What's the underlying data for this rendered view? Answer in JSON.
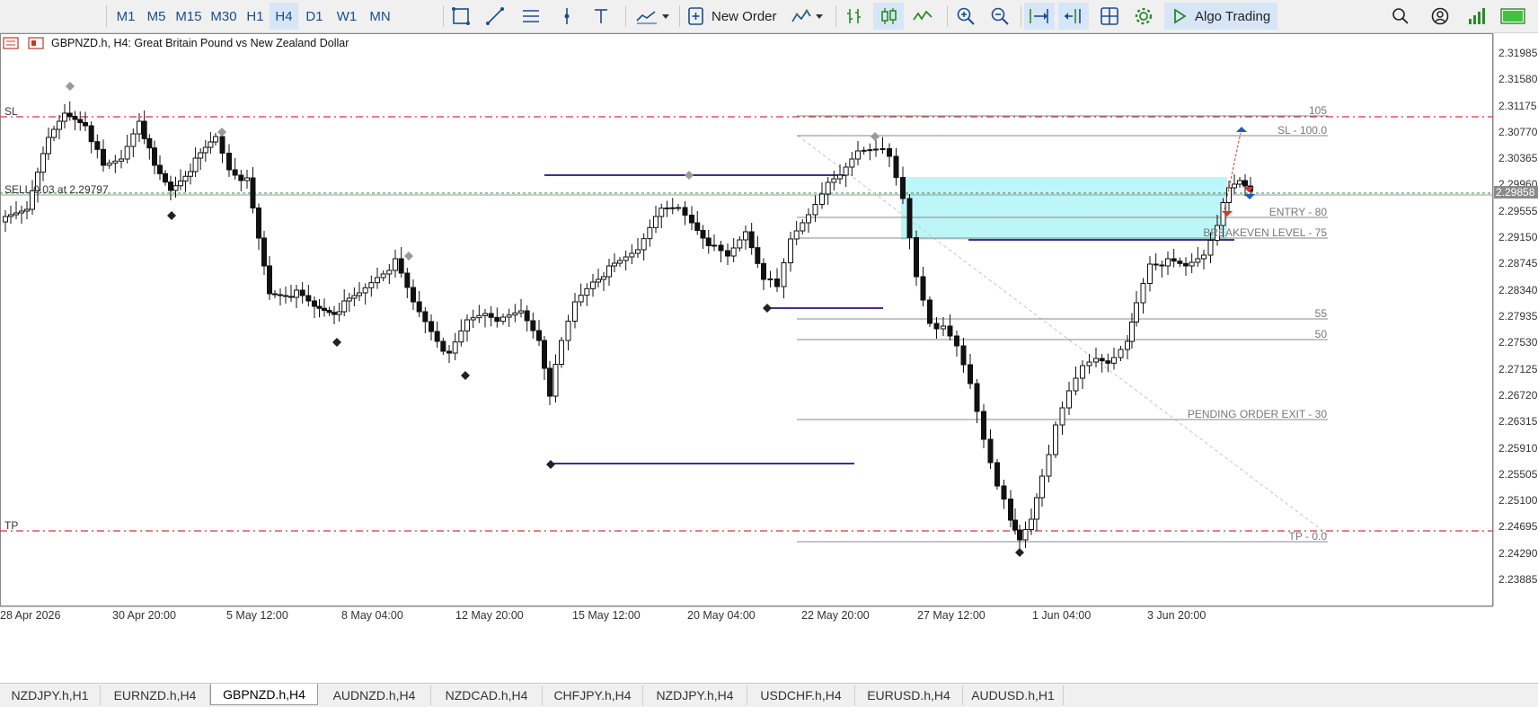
{
  "toolbar": {
    "timeframes": [
      "M1",
      "M5",
      "M15",
      "M30",
      "H1",
      "H4",
      "D1",
      "W1",
      "MN"
    ],
    "active_timeframe": "H4",
    "new_order_label": "New Order",
    "algo_trading_label": "Algo Trading"
  },
  "chart": {
    "title": "GBPNZD.h, H4:  Great Britain Pound vs New Zealand Dollar",
    "price_levels": [
      "2.31985",
      "2.31580",
      "2.31175",
      "2.30770",
      "2.30365",
      "2.29960",
      "2.29555",
      "2.29150",
      "2.28745",
      "2.28340",
      "2.27935",
      "2.27530",
      "2.27125",
      "2.26720",
      "2.26315",
      "2.25910",
      "2.25505",
      "2.25100",
      "2.24695",
      "2.24290",
      "2.23885"
    ],
    "current_price": "2.29858",
    "dates": [
      "28 Apr 2026",
      "30 Apr 20:00",
      "5 May 12:00",
      "8 May 04:00",
      "12 May 20:00",
      "15 May 12:00",
      "20 May 04:00",
      "22 May 20:00",
      "27 May 12:00",
      "1 Jun 04:00",
      "3 Jun 20:00"
    ],
    "labels": {
      "sl": "SL",
      "tp": "TP",
      "sell_order": "SELL 0.03 at 2.29797"
    },
    "fib_levels": [
      {
        "label": "105"
      },
      {
        "label": "SL - 100.0"
      },
      {
        "label": "ENTRY - 80"
      },
      {
        "label": "BREAKEVEN LEVEL - 75"
      },
      {
        "label": "55"
      },
      {
        "label": "50"
      },
      {
        "label": "PENDING ORDER EXIT - 30"
      },
      {
        "label": "TP - 0.0"
      }
    ],
    "colors": {
      "bull": "#ffffff",
      "bear": "#111111",
      "sl_tp_line": "#e03030",
      "zone": "#b8f5f7",
      "level_line": "#5a2d91",
      "fib_line": "#9a9a9a"
    }
  },
  "tabs": [
    "NZDJPY.h,H1",
    "EURNZD.h,H4",
    "GBPNZD.h,H4",
    "AUDNZD.h,H4",
    "NZDCAD.h,H4",
    "CHFJPY.h,H4",
    "NZDJPY.h,H4",
    "USDCHF.h,H4",
    "EURUSD.h,H4",
    "AUDUSD.h,H1"
  ],
  "active_tab": "GBPNZD.h,H4"
}
